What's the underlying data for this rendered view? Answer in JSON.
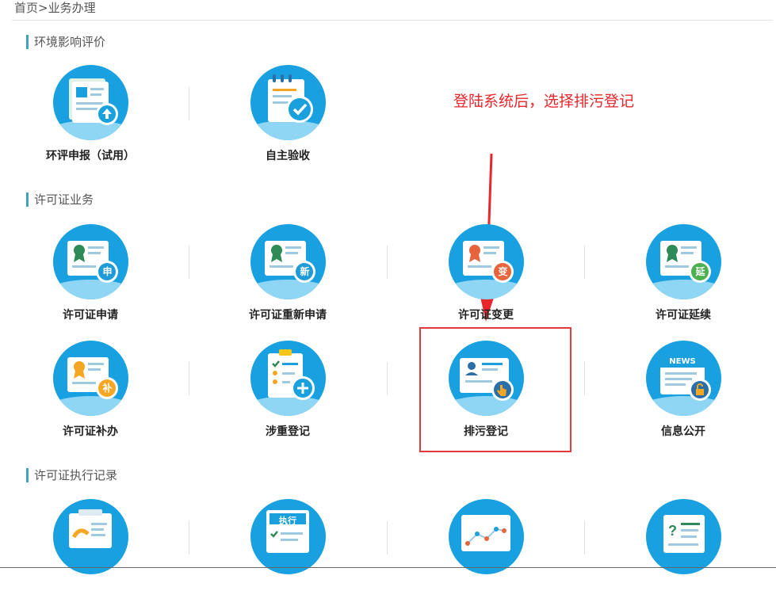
{
  "breadcrumb": {
    "home": "首页",
    "separator": ">",
    "current": "业务办理"
  },
  "sections": {
    "eia": {
      "title": "环境影响评价"
    },
    "permit": {
      "title": "许可证业务"
    },
    "records": {
      "title": "许可证执行记录"
    }
  },
  "tiles": {
    "eia_report": {
      "label": "环评申报（试用）",
      "icon": "document-upload-icon"
    },
    "self_acceptance": {
      "label": "自主验收",
      "icon": "clipboard-check-icon"
    },
    "permit_apply": {
      "label": "许可证申请",
      "badge": "申",
      "icon": "certificate-apply-icon",
      "badge_color": "#1f9bd8"
    },
    "permit_reapply": {
      "label": "许可证重新申请",
      "badge": "新",
      "icon": "certificate-new-icon",
      "badge_color": "#1f9bd8"
    },
    "permit_change": {
      "label": "许可证变更",
      "badge": "变",
      "icon": "certificate-change-icon",
      "badge_color": "#e8643c"
    },
    "permit_extend": {
      "label": "许可证延续",
      "badge": "延",
      "icon": "certificate-extend-icon",
      "badge_color": "#4caf50"
    },
    "permit_reissue": {
      "label": "许可证补办",
      "badge": "补",
      "icon": "certificate-reissue-icon",
      "badge_color": "#f5a623"
    },
    "key_registration": {
      "label": "涉重登记",
      "icon": "checklist-add-icon"
    },
    "discharge_registration": {
      "label": "排污登记",
      "icon": "id-card-hand-icon"
    },
    "info_public": {
      "label": "信息公开",
      "news_text": "NEWS",
      "icon": "news-lock-icon"
    },
    "record_1": {
      "icon": "report-chart-icon"
    },
    "record_2": {
      "label_on_icon": "执行",
      "icon": "execution-form-icon"
    },
    "record_3": {
      "icon": "line-chart-icon"
    },
    "record_4": {
      "icon": "question-list-icon"
    }
  },
  "annotation": {
    "text": "登陆系统后，选择排污登记",
    "color": "#e8262b"
  },
  "colors": {
    "accent": "#3fa4b9",
    "icon_bg": "#18a0e0",
    "highlight": "#e23a3a"
  }
}
